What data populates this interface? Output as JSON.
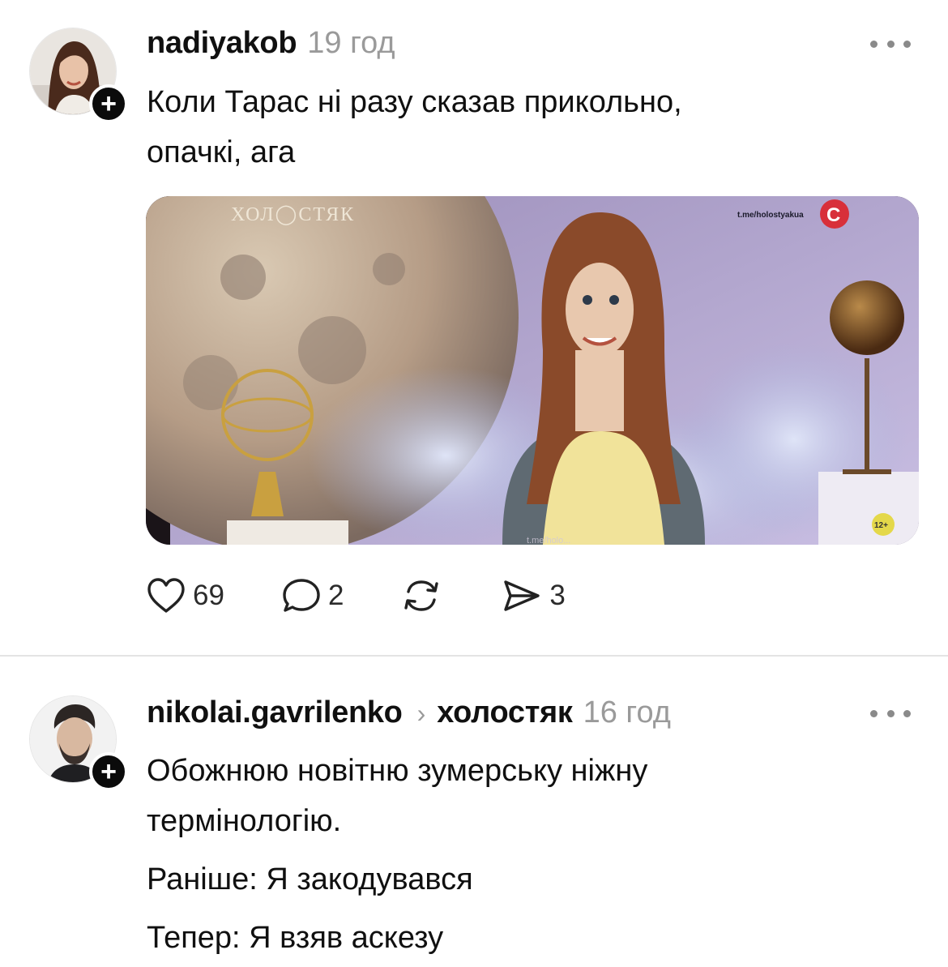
{
  "posts": [
    {
      "username": "nadiyakob",
      "time": "19 год",
      "text": [
        "Коли Тарас ні разу сказав прикольно,",
        "опачкі, ага"
      ],
      "media": {
        "show_logo": "ХОЛ◯СТЯК",
        "channel_link": "t.me/holostyakua",
        "age_rating": "12+",
        "watermark": "t.me/holo..."
      },
      "stats": {
        "likes": "69",
        "comments": "2",
        "shares": "3"
      }
    },
    {
      "username": "nikolai.gavrilenko",
      "community": "холостяк",
      "time": "16 год",
      "text": [
        "Обожнюю новітню зумерську ніжну",
        "термінологію.",
        "Раніше: Я закодувався",
        "Тепер: Я взяв аскезу"
      ]
    }
  ],
  "icons": {
    "follow": "plus-icon",
    "more": "more-icon",
    "like": "heart-icon",
    "comment": "comment-icon",
    "repost": "repost-icon",
    "share": "send-icon"
  }
}
